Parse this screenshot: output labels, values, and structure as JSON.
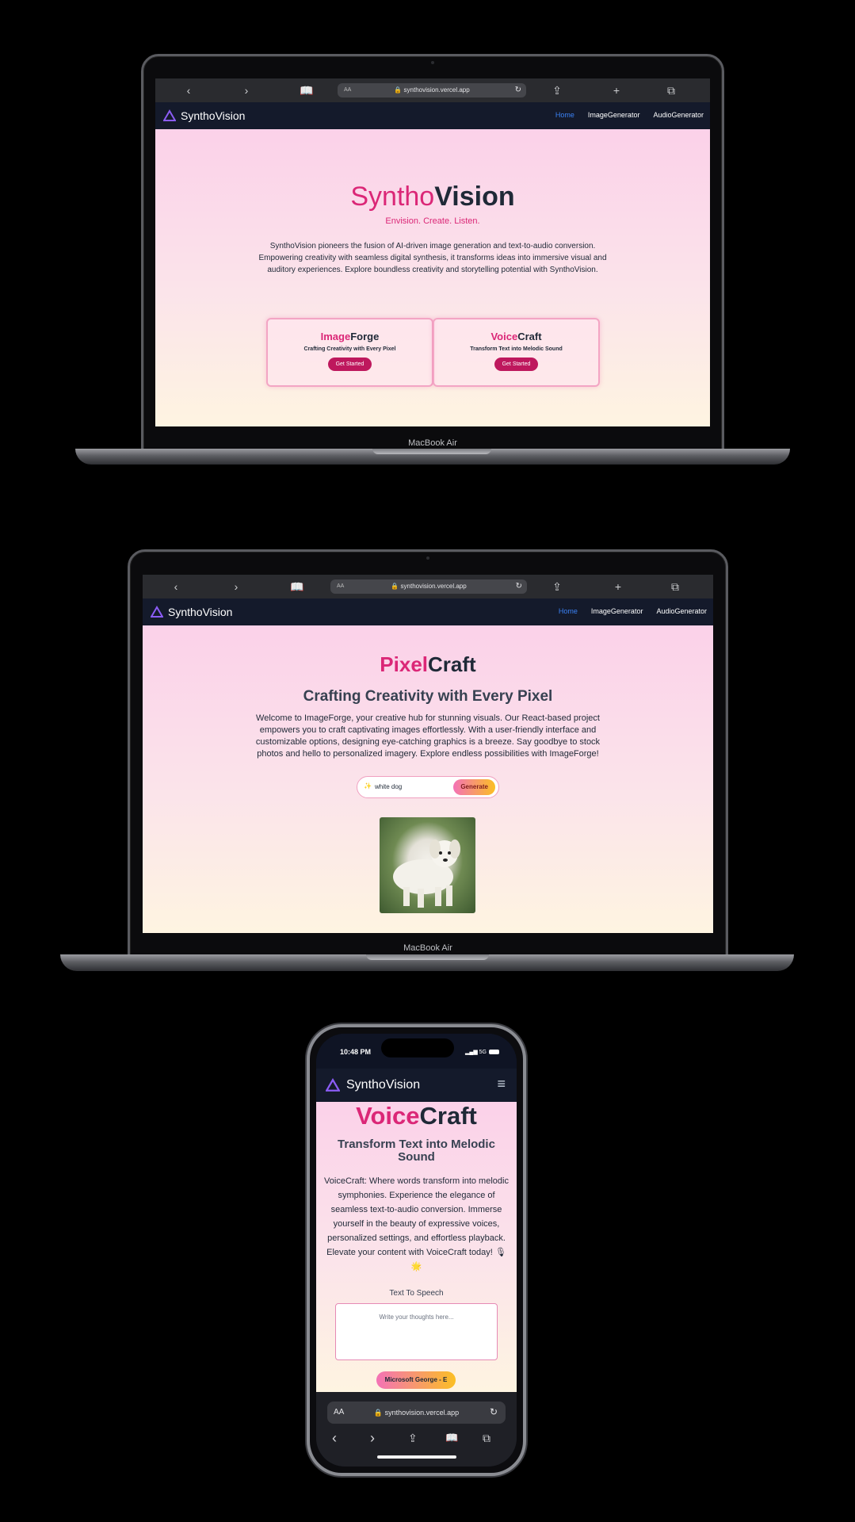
{
  "browser": {
    "url": "synthovision.vercel.app",
    "text_size_label": "AA",
    "mobile_text_size_label": "AA",
    "back_icon": "‹",
    "forward_icon": "›",
    "bookmarks_icon": "book-icon",
    "share_icon": "share-icon",
    "new_tab_icon": "+",
    "tabs_icon": "tabs-icon"
  },
  "nav": {
    "brand": "SynthoVision",
    "links": [
      "Home",
      "ImageGenerator",
      "AudioGenerator"
    ],
    "active_color": "#3b82f6",
    "bar_color": "#141a2b"
  },
  "device_label": "MacBook Air",
  "home": {
    "title_part1": "Syntho",
    "title_part2": "Vision",
    "tagline": "Envision. Create. Listen.",
    "description": "SynthoVision pioneers the fusion of AI-driven image generation and text-to-audio conversion. Empowering creativity with seamless digital synthesis, it transforms ideas into immersive visual and auditory experiences. Explore boundless creativity and storytelling potential with SynthoVision.",
    "cards": [
      {
        "title_part1": "Image",
        "title_part2": "Forge",
        "subtitle": "Crafting Creativity with Every Pixel",
        "button": "Get Started"
      },
      {
        "title_part1": "Voice",
        "title_part2": "Craft",
        "subtitle": "Transform Text into Melodic Sound",
        "button": "Get Started"
      }
    ]
  },
  "image_page": {
    "title_part1": "Pixel",
    "title_part2": "Craft",
    "subtitle": "Crafting Creativity with Every Pixel",
    "description": "Welcome to ImageForge, your creative hub for stunning visuals. Our React-based project empowers you to craft captivating images effortlessly. With a user-friendly interface and customizable options, designing eye-catching graphics is a breeze. Say goodbye to stock photos and hello to personalized imagery. Explore endless possibilities with ImageForge!",
    "input_value": "white dog",
    "input_icon": "✨",
    "generate_button": "Generate"
  },
  "phone": {
    "time": "10:48 PM",
    "signal": "5G",
    "brand": "SynthoVision",
    "title_part1": "Voice",
    "title_part2": "Craft",
    "subtitle": "Transform Text into Melodic Sound",
    "description": "VoiceCraft: Where words transform into melodic symphonies. Experience the elegance of seamless text-to-audio conversion. Immerse yourself in the beauty of expressive voices, personalized settings, and effortless playback. Elevate your content with VoiceCraft today! 🎙 🌟",
    "tts_label": "Text To Speech",
    "textarea_placeholder": "Write your thoughts here...",
    "voice_select": "Microsoft George - E",
    "url": "synthovision.vercel.app"
  },
  "colors": {
    "accent_pink": "#db2777",
    "button_pink": "#be185d",
    "page_gradient_top": "#fbd1e9",
    "page_gradient_bottom": "#fef4e1"
  }
}
